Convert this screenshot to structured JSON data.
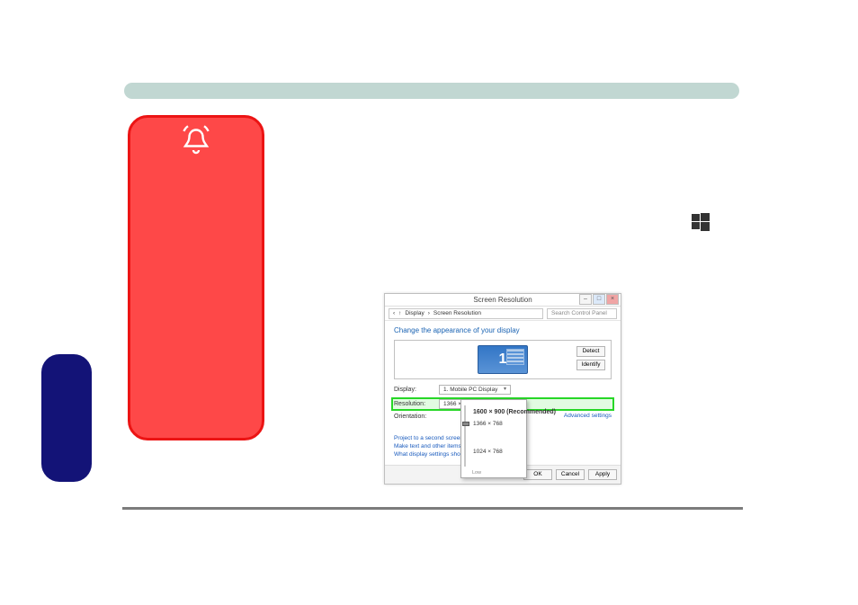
{
  "colors": {
    "topBar": "#c1d7d2",
    "redPanel": "#fe4848",
    "redBorder": "#ec1414",
    "bluePanel": "#131377",
    "accentLink": "#185abd",
    "highlight": "#27d727"
  },
  "sr": {
    "title": "Screen Resolution",
    "breadcrumb_sep": "›",
    "breadcrumb_1": "Display",
    "breadcrumb_2": "Screen Resolution",
    "search_placeholder": "Search Control Panel",
    "heading": "Change the appearance of your display",
    "monitor_number": "1",
    "detect_btn": "Detect",
    "identify_btn": "Identify",
    "display_label": "Display:",
    "display_value": "1. Mobile PC Display",
    "resolution_label": "Resolution:",
    "resolution_value": "1366 × 768",
    "orientation_label": "Orientation:",
    "advanced_link": "Advanced settings",
    "link1": "Project to a second screen",
    "link2": "Make text and other items larger or smaller",
    "link3": "What display settings should I choose?",
    "ok": "OK",
    "cancel": "Cancel",
    "apply": "Apply"
  },
  "res_popup": {
    "recommended": "1600 × 900 (Recommended)",
    "mid": "1366 × 768",
    "low": "1024 × 768",
    "low_label": "Low"
  }
}
